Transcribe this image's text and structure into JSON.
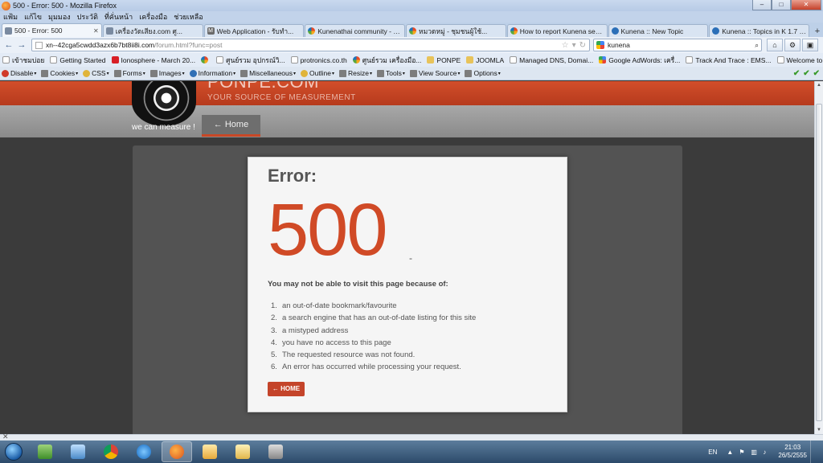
{
  "window": {
    "title": "500 - Error: 500 - Mozilla Firefox",
    "minimize": "–",
    "maximize": "□",
    "close": "✕"
  },
  "menu": [
    "แฟ้ม",
    "แก้ไข",
    "มุมมอง",
    "ประวัติ",
    "ที่คั่นหน้า",
    "เครื่องมือ",
    "ช่วยเหลือ"
  ],
  "tabs": [
    {
      "label": "500 - Error: 500",
      "icon": "page-icon"
    },
    {
      "label": "เครื่องวัดเสียง.com ศู...",
      "icon": "page-icon"
    },
    {
      "label": "Web Application - รับทำ...",
      "icon": "m-icon"
    },
    {
      "label": "Kunenathai community - K...",
      "icon": "joomla-icon"
    },
    {
      "label": "หมวดหมู่ - ชุมชนผู้ใช้...",
      "icon": "joomla-icon"
    },
    {
      "label": "How to report Kunena setti...",
      "icon": "joomla-icon"
    },
    {
      "label": "Kunena :: New Topic",
      "icon": "kunena-icon"
    },
    {
      "label": "Kunena :: Topics in K 1.7 Su...",
      "icon": "kunena-icon"
    }
  ],
  "nav": {
    "url_host": "xn--42cga5cwdd3azx6b7bt8ii8i.com",
    "url_path": "/forum.html?func=post",
    "search_value": "kunena",
    "back": "←",
    "forward": "→"
  },
  "bookmarks": [
    {
      "label": "เข้าชมบ่อย",
      "icon": "page"
    },
    {
      "label": "Getting Started",
      "icon": "page"
    },
    {
      "label": "Ionosphere - March 20...",
      "icon": "pp"
    },
    {
      "label": "",
      "icon": "j"
    },
    {
      "label": "ศูนย์รวม อุปกรณ์วิ...",
      "icon": "page"
    },
    {
      "label": "protronics.co.th",
      "icon": "page"
    },
    {
      "label": "ศูนย์รวม เครื่องมือ...",
      "icon": "j"
    },
    {
      "label": "PONPE",
      "icon": "folder"
    },
    {
      "label": "JOOMLA",
      "icon": "folder"
    },
    {
      "label": "Managed DNS, Domai...",
      "icon": "page"
    },
    {
      "label": "Google AdWords: เครื่...",
      "icon": "g"
    },
    {
      "label": "Track And Trace : EMS...",
      "icon": "page"
    },
    {
      "label": "Welcome to KTB Corp...",
      "icon": "page"
    }
  ],
  "devtools": [
    {
      "label": "Disable",
      "icon": "red"
    },
    {
      "label": "Cookies",
      "icon": "gry"
    },
    {
      "label": "CSS",
      "icon": "yel"
    },
    {
      "label": "Forms",
      "icon": "gry"
    },
    {
      "label": "Images",
      "icon": "gry"
    },
    {
      "label": "Information",
      "icon": "blue"
    },
    {
      "label": "Miscellaneous",
      "icon": "gry"
    },
    {
      "label": "Outline",
      "icon": "yel"
    },
    {
      "label": "Resize",
      "icon": "gry"
    },
    {
      "label": "Tools",
      "icon": "gry"
    },
    {
      "label": "View Source",
      "icon": "gry"
    },
    {
      "label": "Options",
      "icon": "gry"
    }
  ],
  "site": {
    "name": "PONPE.COM",
    "tagline": "YOUR SOURCE OF MEASUREMENT",
    "logo_caption": "we can measure !",
    "home_tab": "← Home"
  },
  "error": {
    "title": "Error:",
    "code": "500",
    "code_suffix": "-",
    "lead": "You may not be able to visit this page because of:",
    "reasons": [
      "an out-of-date bookmark/favourite",
      "a search engine that has an out-of-date listing for this site",
      "a mistyped address",
      "you have no access to this page",
      "The requested resource was not found.",
      "An error has occurred while processing your request."
    ],
    "home_button": "← HOME"
  },
  "taskbar": {
    "lang": "EN",
    "time": "21:03",
    "date": "26/5/2555"
  },
  "colors": {
    "accent": "#d04a26",
    "header": "#c4442a"
  }
}
